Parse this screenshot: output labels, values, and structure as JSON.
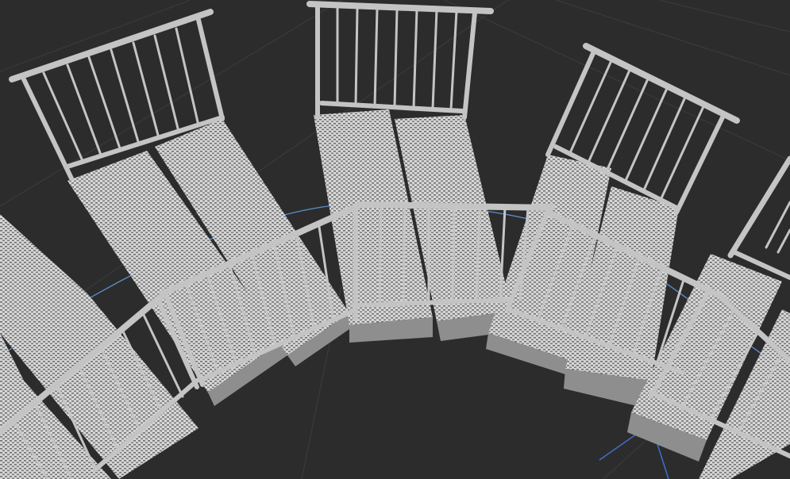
{
  "viewport": {
    "background_color": "#2c2c2c",
    "grid_color": "#3a3a3a",
    "helix_guide_color": "#5d8fd0",
    "axis_color": "#3f6fcf",
    "tread_color": "#cfcfcf",
    "tread_side_color": "#8e8e8e",
    "railing_color": "#c4c4c4"
  },
  "scene": {
    "object": "spiral-staircase",
    "step_count_visible": 10,
    "railings_visible": 6,
    "tread_pattern": "grating"
  }
}
